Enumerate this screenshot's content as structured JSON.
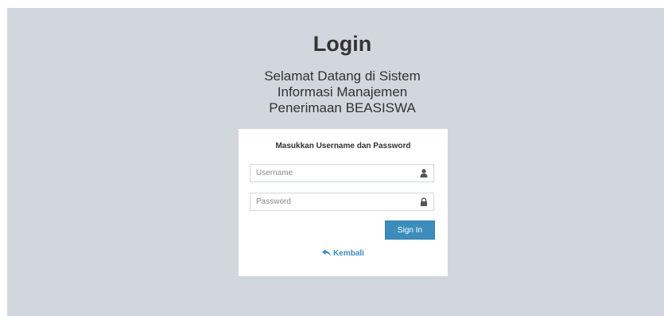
{
  "login": {
    "title": "Login",
    "welcome_lines": [
      "Selamat Datang di Sistem",
      "Informasi Manajemen",
      "Penerimaan BEASISWA"
    ],
    "box_message": "Masukkan Username dan Password",
    "username_placeholder": "Username",
    "password_placeholder": "Password",
    "username_icon": "user-icon",
    "password_icon": "lock-icon",
    "signin_label": "Sign In",
    "back_label": "Kembali",
    "back_icon": "reply-icon"
  },
  "colors": {
    "background": "#d2d6de",
    "box": "#ffffff",
    "primary_button": "#3c8dbc",
    "link": "#3c8dbc"
  }
}
